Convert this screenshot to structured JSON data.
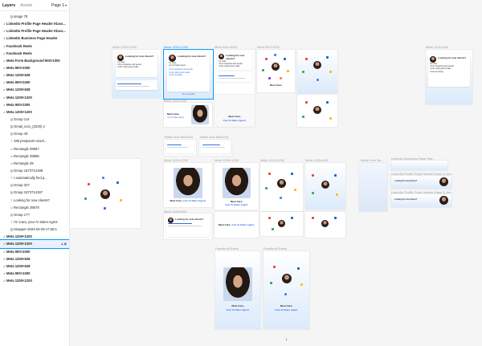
{
  "sidebar": {
    "tabs": [
      {
        "label": "Layers",
        "active": true
      },
      {
        "label": "Assets",
        "active": false
      }
    ],
    "page_selector": "Page 1",
    "layers": [
      {
        "icon": "image",
        "label": "image 78",
        "bold": false
      },
      {
        "icon": "frame",
        "label": "LinkedIn Profile Page Header Klass...",
        "bold": true
      },
      {
        "icon": "frame",
        "label": "LinkedIn Profile Page Header Klass...",
        "bold": true
      },
      {
        "icon": "frame",
        "label": "LinkedIn Business Page Header",
        "bold": true
      },
      {
        "icon": "frame",
        "label": "Facebook Reels",
        "bold": true
      },
      {
        "icon": "frame",
        "label": "Facebook Reels",
        "bold": true
      },
      {
        "icon": "frame",
        "label": "Meta Form Background 900×1000",
        "bold": true
      },
      {
        "icon": "frame",
        "label": "Meta 900×1000",
        "bold": true
      },
      {
        "icon": "frame",
        "label": "Meta 1200×628",
        "bold": true
      },
      {
        "icon": "frame",
        "label": "Meta 900×1000",
        "bold": true
      },
      {
        "icon": "frame",
        "label": "Meta 1200×628",
        "bold": true
      },
      {
        "icon": "frame",
        "label": "Meta 1200×1200",
        "bold": true
      },
      {
        "icon": "frame",
        "label": "Meta 900×1000",
        "bold": true
      },
      {
        "icon": "frame",
        "label": "Meta 1200×1200",
        "bold": true
      },
      {
        "icon": "group",
        "label": "Group 114",
        "bold": false
      },
      {
        "icon": "image",
        "label": "Gmail_icon_(2020) 2",
        "bold": false
      },
      {
        "icon": "group",
        "label": "Group 49",
        "bold": false
      },
      {
        "icon": "text",
        "label": "188 prospects reach...",
        "bold": false
      },
      {
        "icon": "rect",
        "label": "Rectangle 39587",
        "bold": false
      },
      {
        "icon": "rect",
        "label": "Rectangle 39586",
        "bold": false
      },
      {
        "icon": "rect",
        "label": "Rectangle 39",
        "bold": false
      },
      {
        "icon": "group",
        "label": "Group 1873714198",
        "bold": false
      },
      {
        "icon": "text",
        "label": "I automatically find p...",
        "bold": false
      },
      {
        "icon": "group",
        "label": "Group 327",
        "bold": false
      },
      {
        "icon": "group",
        "label": "Group 1873714197",
        "bold": false
      },
      {
        "icon": "text",
        "label": "Looking for new clients?",
        "bold": false
      },
      {
        "icon": "rect",
        "label": "Rectangle 39578",
        "bold": false
      },
      {
        "icon": "group",
        "label": "Group 1??",
        "bold": false
      },
      {
        "icon": "text",
        "label": "I'm Cara, your AI Sales Agent",
        "bold": false
      },
      {
        "icon": "image",
        "label": "Snapper-2024-04-05-17.58.1",
        "bold": false
      },
      {
        "icon": "frame",
        "label": "Meta 1200×1200",
        "bold": true
      },
      {
        "icon": "frame",
        "label": "Meta 1200×1200",
        "bold": true,
        "selected": true
      },
      {
        "icon": "frame",
        "label": "Meta 900×1000",
        "bold": true
      },
      {
        "icon": "frame",
        "label": "Meta 1200×628",
        "bold": true
      },
      {
        "icon": "frame",
        "label": "Meta 1200×628",
        "bold": true
      },
      {
        "icon": "frame",
        "label": "Meta 900×1000",
        "bold": true
      },
      {
        "icon": "frame",
        "label": "Meta 1200×1200",
        "bold": true
      }
    ]
  },
  "canvas": {
    "frame_labels": [
      "Meta 1200×1200",
      "Meta 1200×1200",
      "Meta 900×1000",
      "Meta 900×1000",
      "Meta 1200×628",
      "Meta 1200×628",
      "Twitter Ads 800x418",
      "Twitter Ads 800x418",
      "Meta 1200×1200",
      "Meta 1200×1200",
      "Meta 1200×1200",
      "Meta 1200×628",
      "Meta Form Ba...",
      "LinkedIn Business Page Hea...",
      "LinkedIn Profile Page Header Klass & Jen...",
      "LinkedIn Profile Page Header Klass & Jen...",
      "Meta 1200×628",
      "Facebook Reels",
      "Facebook Reels"
    ],
    "ad_copy": {
      "looking": "Looking for new clients?",
      "looking_accent": "new clients?",
      "im_cara": "I'm Cara,",
      "sales_agent": "your AI Sales Agent.",
      "bullet_1": "I find companies and people",
      "bullet_2": "I write really good emails",
      "bullet_3": "I book meetings",
      "autopilot": "All on autopilot",
      "meet": "Meet Cara,",
      "meet_accent": "Your AI Sales Agent."
    }
  },
  "colors": {
    "accent": "#0d99ff",
    "brand_blue": "#2f6fe4"
  }
}
